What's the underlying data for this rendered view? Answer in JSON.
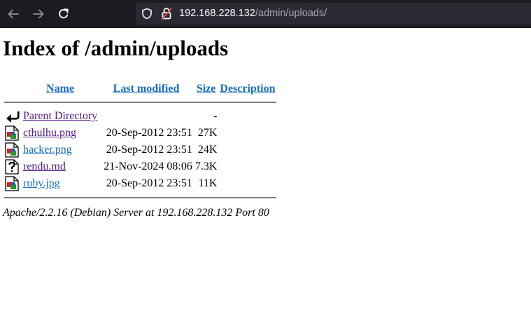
{
  "browser": {
    "url_host": "192.168.228.132",
    "url_path": "/admin/uploads/"
  },
  "page": {
    "title": "Index of /admin/uploads",
    "columns": {
      "name": "Name",
      "last_modified": "Last modified",
      "size": "Size",
      "description": "Description"
    },
    "parent": {
      "label": "Parent Directory",
      "size": "-"
    },
    "files": [
      {
        "name": "cthulhu.png",
        "modified": "20-Sep-2012 23:51",
        "size": "27K",
        "icon": "image-icon"
      },
      {
        "name": "hacker.png",
        "modified": "20-Sep-2012 23:51",
        "size": "24K",
        "icon": "image-icon"
      },
      {
        "name": "rendu.md",
        "modified": "21-Nov-2024 08:06",
        "size": "7.3K",
        "icon": "unknown-file-icon"
      },
      {
        "name": "ruby.jpg",
        "modified": "20-Sep-2012 23:51",
        "size": "11K",
        "icon": "image-icon"
      }
    ],
    "footer": "Apache/2.2.16 (Debian) Server at 192.168.228.132 Port 80"
  }
}
